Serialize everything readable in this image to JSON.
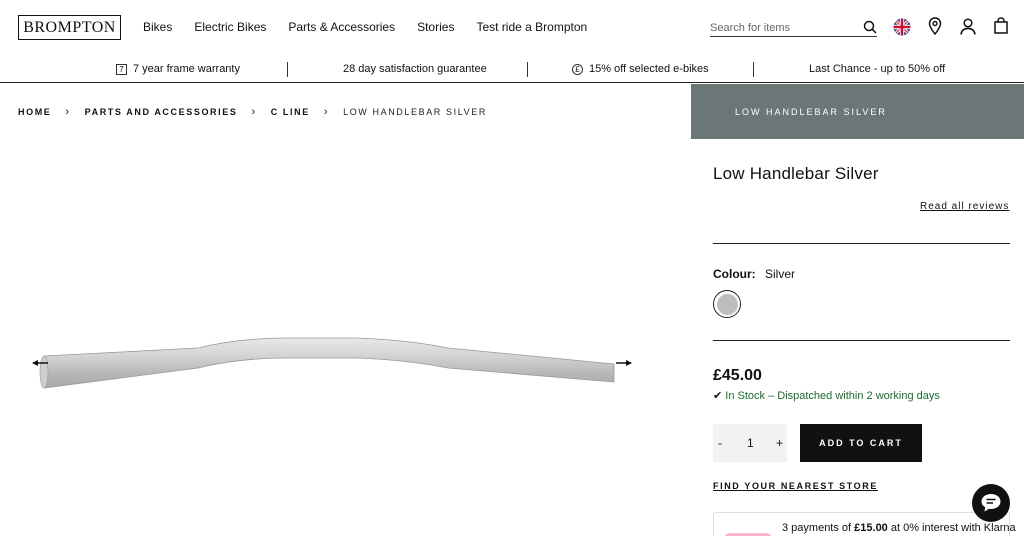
{
  "header": {
    "logo": "BROMPTON",
    "nav": [
      "Bikes",
      "Electric Bikes",
      "Parts & Accessories",
      "Stories",
      "Test ride a Brompton"
    ],
    "search_placeholder": "Search for items",
    "icons": [
      "search-icon",
      "uk-flag-icon",
      "location-pin-icon",
      "account-icon",
      "shopping-bag-icon"
    ]
  },
  "usp": {
    "items": [
      {
        "badge": "7",
        "text": "7 year frame warranty"
      },
      {
        "badge": "",
        "text": "28 day satisfaction guarantee"
      },
      {
        "badge": "£",
        "text": "15% off selected e-bikes"
      },
      {
        "badge": "",
        "text": "Last Chance - up to 50% off"
      }
    ]
  },
  "breadcrumb": [
    "Home",
    "Parts and Accessories",
    "C Line",
    "Low Handlebar Silver"
  ],
  "panel": {
    "header": "LOW HANDLEBAR SILVER",
    "title": "Low Handlebar Silver",
    "reviews_link": "Read all reviews",
    "colour_label": "Colour:",
    "colour_value": "Silver",
    "price": "£45.00",
    "stock": "In Stock – Dispatched within 2 working days",
    "qty_minus": "-",
    "qty_value": "1",
    "qty_plus": "+",
    "add_to_cart": "ADD TO CART",
    "find_store": "FIND YOUR NEAREST STORE",
    "klarna_prefix": "3 payments of ",
    "klarna_amount": "£15.00",
    "klarna_suffix": " at 0% interest with Klarna"
  },
  "colors": {
    "panel_header_bg": "#6a7776",
    "stock_green": "#1b6b2e",
    "klarna_pink": "#ffb3c7",
    "handlebar_silver": "#c9c9c9"
  }
}
